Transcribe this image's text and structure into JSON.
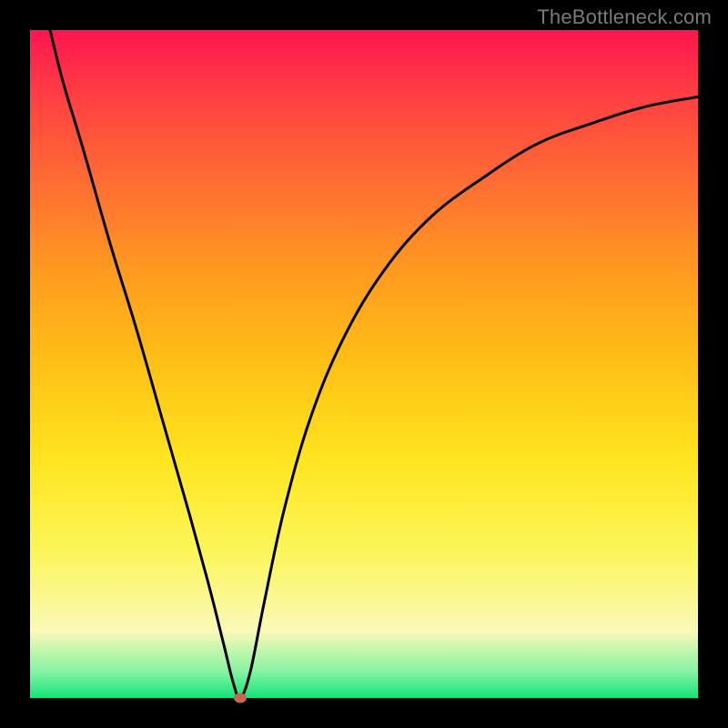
{
  "watermark": "TheBottleneck.com",
  "chart_data": {
    "type": "line",
    "title": "",
    "xlabel": "",
    "ylabel": "",
    "xlim": [
      0,
      100
    ],
    "ylim": [
      0,
      100
    ],
    "grid": false,
    "legend": false,
    "background_gradient": {
      "top": "#ff1550",
      "middle": "#ffe41e",
      "bottom": "#13e57a"
    },
    "series": [
      {
        "name": "bottleneck-curve",
        "color": "#000000",
        "x": [
          3,
          5,
          8,
          12,
          16,
          20,
          24,
          27,
          29,
          30.5,
          31.5,
          33,
          35,
          38,
          42,
          47,
          53,
          60,
          68,
          76,
          84,
          92,
          100
        ],
        "y": [
          100,
          92,
          82,
          68,
          55,
          41,
          27,
          16,
          8,
          2,
          0,
          4,
          14,
          28,
          42,
          54,
          64,
          72,
          78,
          83,
          86,
          88.5,
          90
        ]
      }
    ],
    "marker": {
      "name": "optimal-point",
      "x": 31.5,
      "y": 0,
      "color": "#c2694f"
    }
  }
}
